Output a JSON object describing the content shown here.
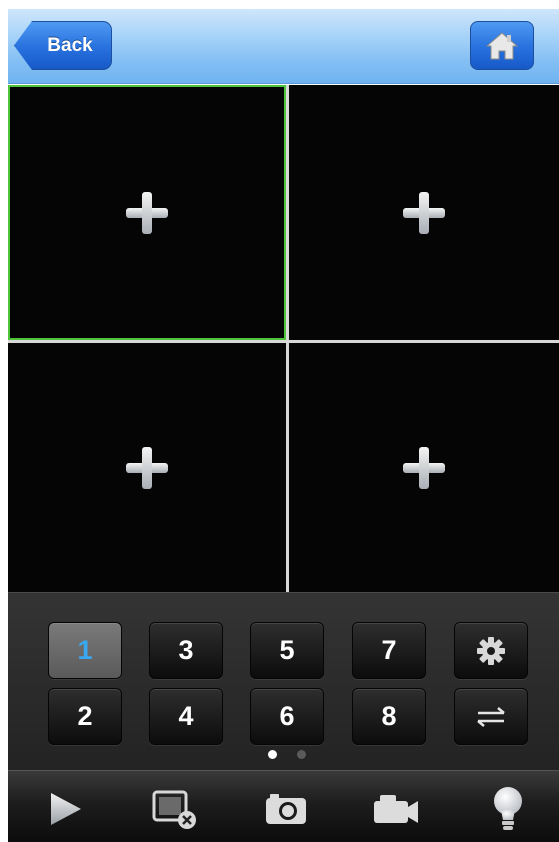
{
  "navbar": {
    "back_label": "Back",
    "home_icon": "home-icon"
  },
  "grid": {
    "cells": [
      {
        "icon": "plus-icon",
        "selected": true
      },
      {
        "icon": "plus-icon",
        "selected": false
      },
      {
        "icon": "plus-icon",
        "selected": false
      },
      {
        "icon": "plus-icon",
        "selected": false
      }
    ]
  },
  "channels": {
    "row1": [
      "1",
      "3",
      "5",
      "7"
    ],
    "row2": [
      "2",
      "4",
      "6",
      "8"
    ],
    "active": "1",
    "settings_icon": "gear-icon",
    "switch_icon": "swap-arrows-icon",
    "page_count": 2,
    "current_page": 1
  },
  "toolbar": {
    "icons": [
      "play-icon",
      "close-window-icon",
      "camera-icon",
      "video-camera-icon",
      "lightbulb-icon"
    ]
  },
  "colors": {
    "accent": "#3aa8f0",
    "selected_border": "#4ec43a",
    "nav_blue": "#2a74e0"
  }
}
